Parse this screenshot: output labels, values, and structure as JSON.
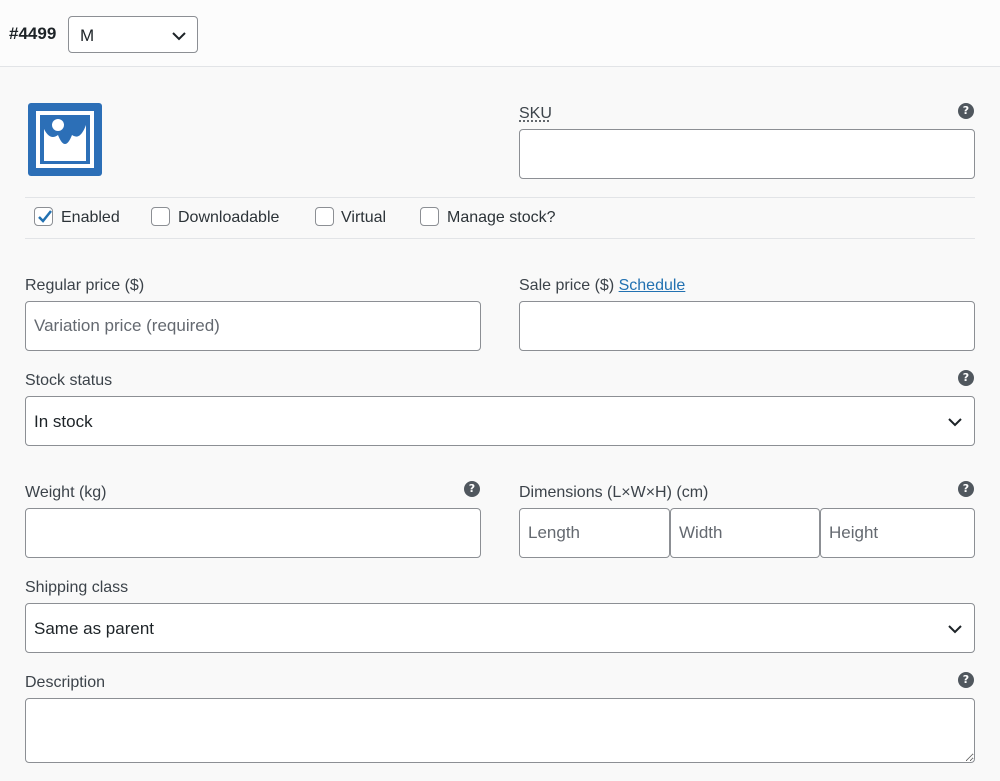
{
  "header": {
    "variation_id": "#4499",
    "attribute_value": "M"
  },
  "thumbnail": {
    "icon": "image-placeholder-icon",
    "color": "#2c6fb7"
  },
  "sku": {
    "label": "SKU",
    "value": ""
  },
  "options": {
    "enabled": {
      "label": "Enabled",
      "checked": true
    },
    "downloadable": {
      "label": "Downloadable",
      "checked": false
    },
    "virtual": {
      "label": "Virtual",
      "checked": false
    },
    "manage_stock": {
      "label": "Manage stock?",
      "checked": false
    }
  },
  "pricing": {
    "regular_label": "Regular price ($)",
    "regular_placeholder": "Variation price (required)",
    "sale_label": "Sale price ($)",
    "sale_link": "Schedule"
  },
  "stock": {
    "label": "Stock status",
    "value": "In stock"
  },
  "weight": {
    "label": "Weight (kg)"
  },
  "dimensions": {
    "label": "Dimensions (L×W×H) (cm)",
    "length_placeholder": "Length",
    "width_placeholder": "Width",
    "height_placeholder": "Height"
  },
  "shipping": {
    "label": "Shipping class",
    "value": "Same as parent"
  },
  "description": {
    "label": "Description"
  },
  "help_glyph": "?",
  "colors": {
    "accent": "#2271b1",
    "checkmark": "#2271b1"
  }
}
